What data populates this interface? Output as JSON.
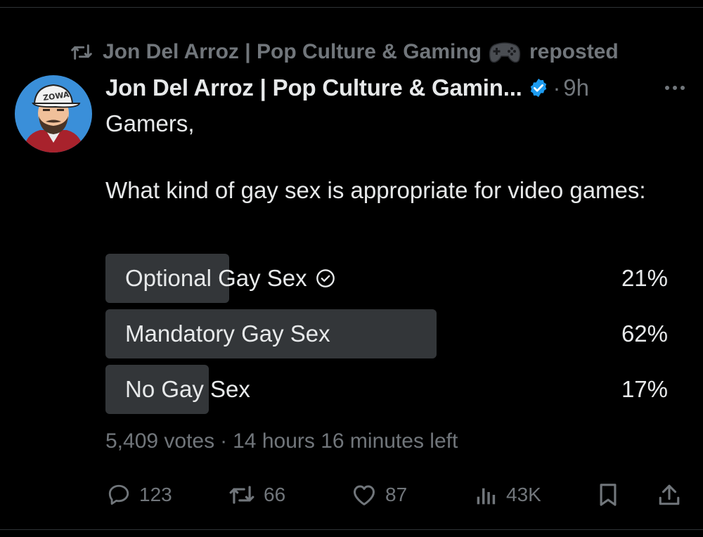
{
  "repost_header": {
    "account": "Jon Del Arroz | Pop Culture & Gaming",
    "emoji_icon": "gamepad-icon",
    "action": "reposted"
  },
  "post": {
    "author": "Jon Del Arroz | Pop Culture & Gamin...",
    "verified": true,
    "separator": "·",
    "time": "9h",
    "greeting": "Gamers,",
    "question": "What kind of gay sex is appropriate for video games:"
  },
  "poll": {
    "options": [
      {
        "label": "Optional Gay Sex",
        "percent_text": "21%",
        "fill": 0.21,
        "selected": true
      },
      {
        "label": "Mandatory Gay Sex",
        "percent_text": "62%",
        "fill": 0.62,
        "selected": false
      },
      {
        "label": "No Gay Sex",
        "percent_text": "17%",
        "fill": 0.17,
        "selected": false
      }
    ],
    "votes": "5,409 votes",
    "separator": "·",
    "time_left": "14 hours 16 minutes left"
  },
  "actions": {
    "replies": "123",
    "reposts": "66",
    "likes": "87",
    "views": "43K"
  },
  "colors": {
    "background": "#000000",
    "text_primary": "#e7e9ea",
    "text_secondary": "#71767b",
    "poll_bar": "#333639",
    "verified_blue": "#1d9bf0"
  }
}
